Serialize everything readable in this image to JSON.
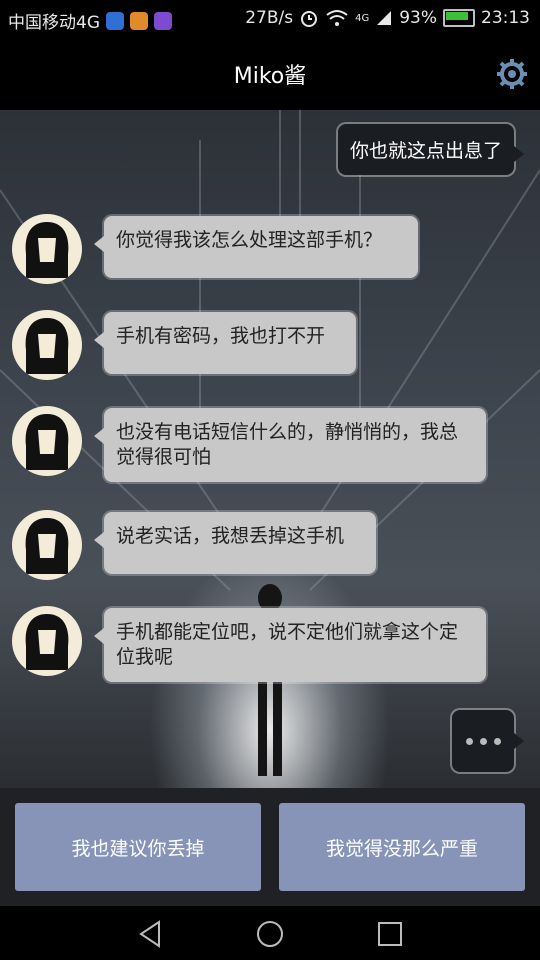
{
  "status_bar": {
    "carrier": "中国移动4G",
    "net_speed": "27B/s",
    "signal_label": "4G",
    "battery": "93%",
    "time": "23:13"
  },
  "header": {
    "title": "Miko酱"
  },
  "chat": {
    "outgoing": "你也就这点出息了",
    "messages": [
      {
        "text": "你觉得我该怎么处理这部手机？"
      },
      {
        "text": "手机有密码，我也打不开"
      },
      {
        "text": "也没有电话短信什么的，静悄悄的，我总觉得很可怕"
      },
      {
        "text": "说老实话，我想丢掉这手机"
      },
      {
        "text": "手机都能定位吧，说不定他们就拿这个定位我呢"
      }
    ]
  },
  "replies": {
    "option1": "我也建议你丢掉",
    "option2": "我觉得没那么严重"
  },
  "colors": {
    "reply_button": "#8794b8",
    "bubble_in": "#c8c8c8",
    "bubble_out": "#1a1d22",
    "gear": "#6a8fb3"
  }
}
